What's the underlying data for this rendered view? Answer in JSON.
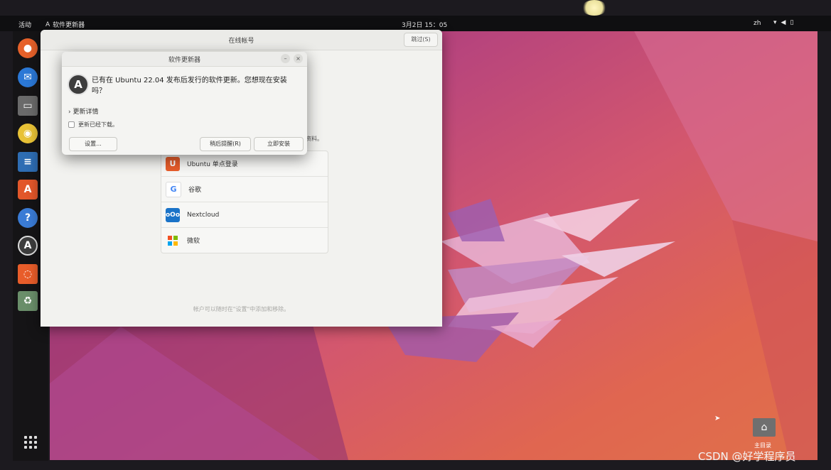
{
  "topbar": {
    "activities": "活动",
    "app_name": "软件更新器",
    "clock": "3月2日  15：05",
    "lang": "zh",
    "tray_icons": [
      "network-icon",
      "volume-icon",
      "battery-icon"
    ]
  },
  "dock": {
    "apps": [
      "firefox",
      "thunderbird",
      "files",
      "rhythmbox",
      "writer",
      "app-center",
      "help",
      "software-updater",
      "trash"
    ]
  },
  "online_accounts": {
    "title": "在线帐号",
    "skip_button": "跳过(S)",
    "partial_text": "资料。",
    "providers": [
      {
        "name": "Ubuntu 单点登录",
        "icon": "ubuntu-sso-icon",
        "color": "#e85d2a"
      },
      {
        "name": "谷歌",
        "icon": "google-icon",
        "color": "#4285f4"
      },
      {
        "name": "Nextcloud",
        "icon": "nextcloud-icon",
        "color": "#1a73c8"
      },
      {
        "name": "微软",
        "icon": "microsoft-icon",
        "color": "#f25022"
      }
    ],
    "footer_note": "帐户可以随时在\"设置\"中添加和移除。"
  },
  "updater": {
    "title": "软件更新器",
    "message": "已有在 Ubuntu 22.04 发布后发行的软件更新。您想现在安装吗？",
    "details_toggle": "更新详情",
    "downloaded_label": "更新已经下载。",
    "settings_button": "设置...",
    "remind_later_button": "稍后提醒(R)",
    "install_now_button": "立即安装"
  },
  "desktop": {
    "home_label": "主目录"
  },
  "watermark": "CSDN @好学程序员"
}
